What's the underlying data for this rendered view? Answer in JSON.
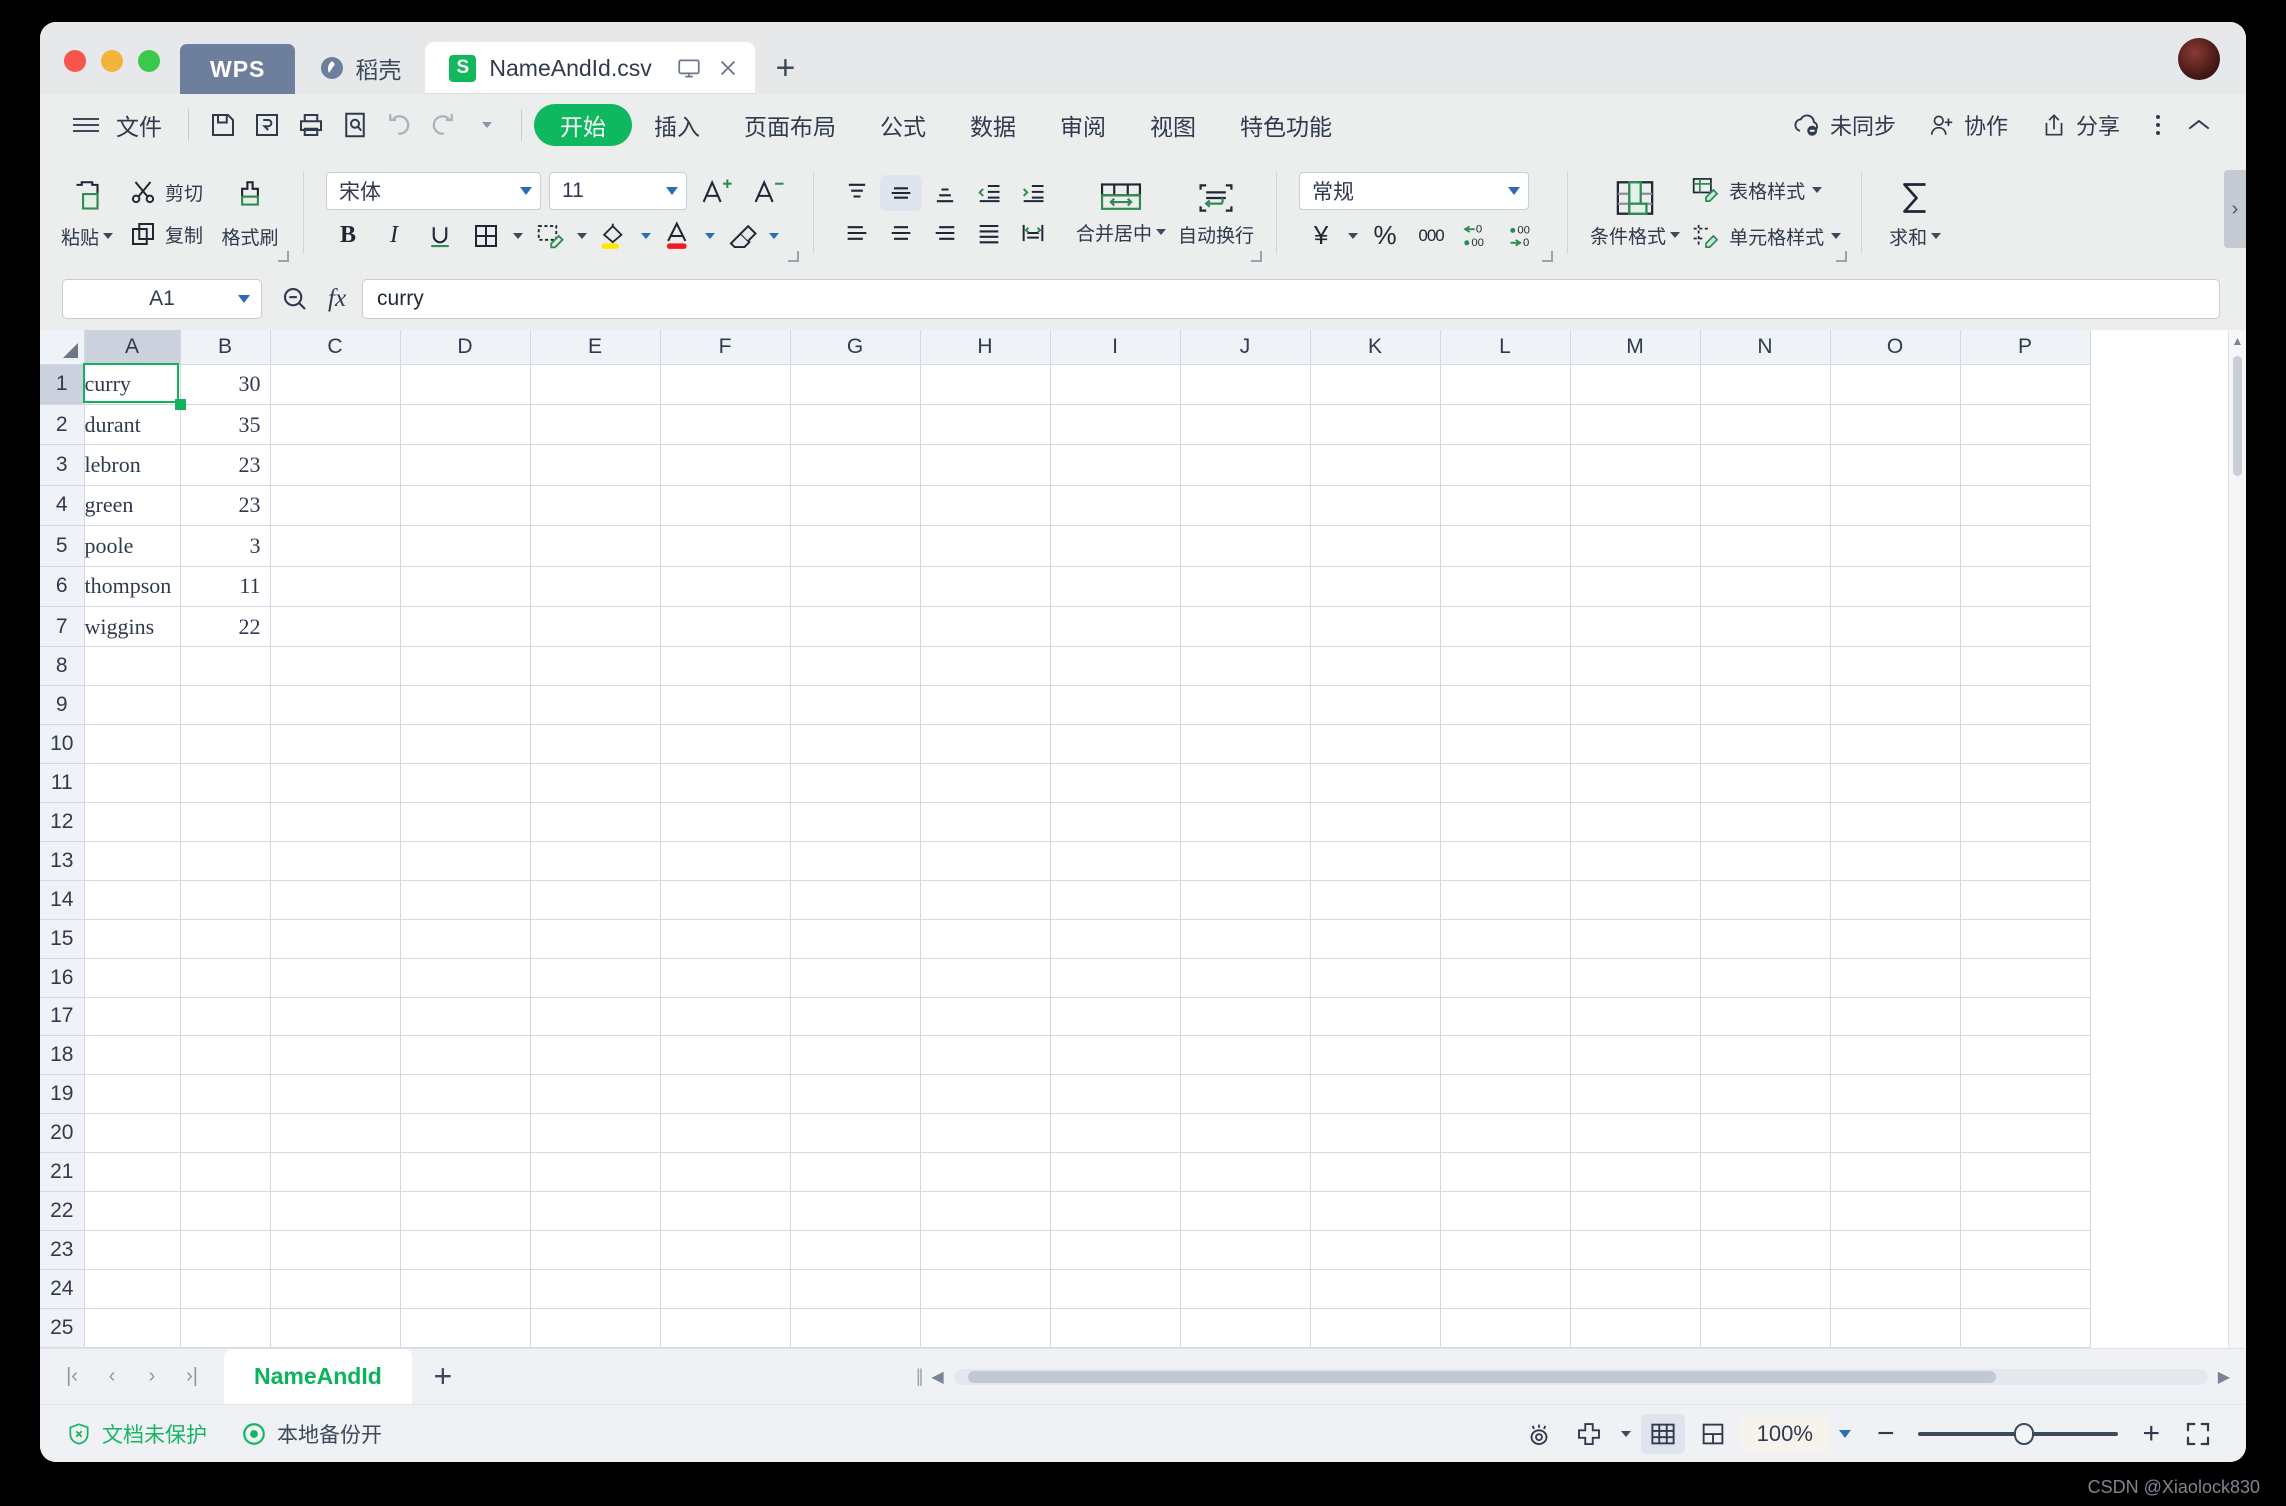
{
  "window": {
    "traffic_lights": [
      "close",
      "minimize",
      "maximize"
    ]
  },
  "titlebar": {
    "tab_wps": "WPS",
    "tab_docer": "稻壳",
    "doc_tab_icon_letter": "S",
    "doc_tab_name": "NameAndId.csv",
    "new_tab_label": "+"
  },
  "menubar": {
    "file": "文件",
    "items": [
      {
        "label": "开始",
        "active": true
      },
      {
        "label": "插入",
        "active": false
      },
      {
        "label": "页面布局",
        "active": false
      },
      {
        "label": "公式",
        "active": false
      },
      {
        "label": "数据",
        "active": false
      },
      {
        "label": "审阅",
        "active": false
      },
      {
        "label": "视图",
        "active": false
      },
      {
        "label": "特色功能",
        "active": false
      }
    ],
    "right": {
      "sync": "未同步",
      "collab": "协作",
      "share": "分享"
    }
  },
  "ribbon": {
    "clipboard": {
      "paste": "粘贴",
      "cut": "剪切",
      "copy": "复制",
      "format_painter": "格式刷"
    },
    "font": {
      "family": "宋体",
      "size": "11",
      "bold": "B",
      "italic": "I",
      "underline": "U"
    },
    "alignment": {
      "merge_center": "合并居中",
      "wrap_text": "自动换行"
    },
    "number": {
      "format": "常规",
      "currency": "¥",
      "percent": "%",
      "comma": "000"
    },
    "styles": {
      "conditional_format": "条件格式",
      "table_style": "表格样式",
      "cell_style": "单元格样式"
    },
    "editing": {
      "autosum": "求和"
    }
  },
  "formulabar": {
    "name_box": "A1",
    "formula_value": "curry"
  },
  "grid": {
    "columns": [
      "A",
      "B",
      "C",
      "D",
      "E",
      "F",
      "G",
      "H",
      "I",
      "J",
      "K",
      "L",
      "M",
      "N",
      "O",
      "P"
    ],
    "selected_column": "A",
    "selected_row": 1,
    "selected_cell": "A1",
    "rows": [
      {
        "n": "1",
        "A": "curry",
        "B": "30"
      },
      {
        "n": "2",
        "A": "durant",
        "B": "35"
      },
      {
        "n": "3",
        "A": "lebron",
        "B": "23"
      },
      {
        "n": "4",
        "A": "green",
        "B": "23"
      },
      {
        "n": "5",
        "A": "poole",
        "B": "3"
      },
      {
        "n": "6",
        "A": "thompson",
        "B": "11"
      },
      {
        "n": "7",
        "A": "wiggins",
        "B": "22"
      },
      {
        "n": "8",
        "A": "",
        "B": ""
      },
      {
        "n": "9",
        "A": "",
        "B": ""
      },
      {
        "n": "10",
        "A": "",
        "B": ""
      },
      {
        "n": "11",
        "A": "",
        "B": ""
      },
      {
        "n": "12",
        "A": "",
        "B": ""
      },
      {
        "n": "13",
        "A": "",
        "B": ""
      },
      {
        "n": "14",
        "A": "",
        "B": ""
      },
      {
        "n": "15",
        "A": "",
        "B": ""
      },
      {
        "n": "16",
        "A": "",
        "B": ""
      },
      {
        "n": "17",
        "A": "",
        "B": ""
      },
      {
        "n": "18",
        "A": "",
        "B": ""
      },
      {
        "n": "19",
        "A": "",
        "B": ""
      },
      {
        "n": "20",
        "A": "",
        "B": ""
      },
      {
        "n": "21",
        "A": "",
        "B": ""
      },
      {
        "n": "22",
        "A": "",
        "B": ""
      },
      {
        "n": "23",
        "A": "",
        "B": ""
      },
      {
        "n": "24",
        "A": "",
        "B": ""
      },
      {
        "n": "25",
        "A": "",
        "B": ""
      }
    ]
  },
  "sheetbar": {
    "sheets": [
      {
        "name": "NameAndId",
        "active": true
      }
    ],
    "add_sheet": "+"
  },
  "statusbar": {
    "protection": "文档未保护",
    "backup": "本地备份开",
    "zoom": "100%"
  },
  "watermark": "CSDN @Xiaolock830",
  "colors": {
    "accent_green": "#0fb85f",
    "sheet_tab_green": "#0bb45c",
    "selection_green": "#12b15c",
    "wps_tab_blue": "#6d7f9c",
    "text_dark": "#2f3b4d"
  }
}
